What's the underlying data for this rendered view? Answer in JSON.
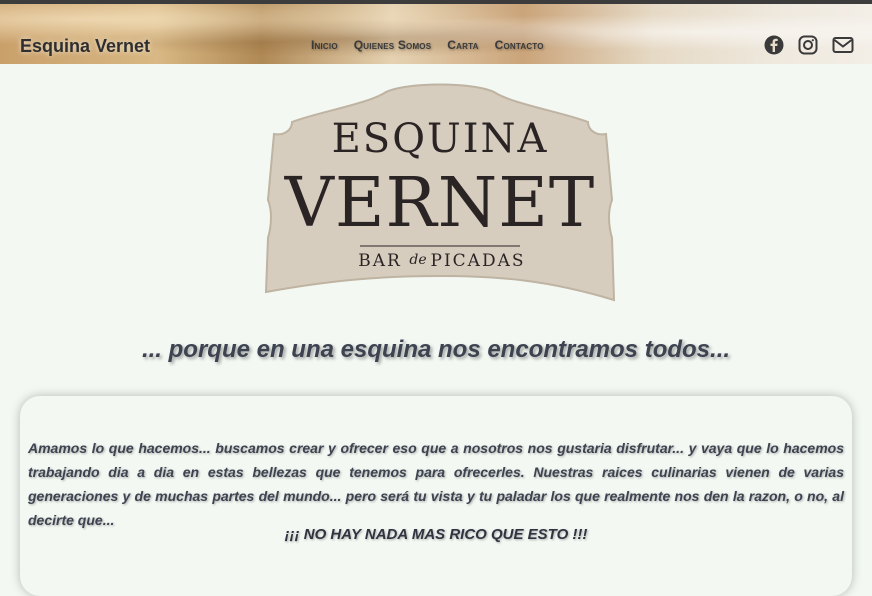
{
  "header": {
    "brand": "Esquina Vernet",
    "nav": [
      "Inicio",
      "Quienes Somos",
      "Carta",
      "Contacto"
    ],
    "social_icons": [
      "facebook-icon",
      "instagram-icon",
      "envelope-icon"
    ]
  },
  "logo": {
    "line1": "ESQUINA",
    "line2": "VERNET",
    "sub_left": "BAR",
    "sub_mid": "de",
    "sub_right": "PICADAS"
  },
  "tagline": "... porque en una esquina nos encontramos todos...",
  "about": {
    "text": "Amamos lo que hacemos... buscamos crear y ofrecer eso que a nosotros nos gustaria disfrutar... y vaya que lo hacemos trabajando dia a dia en estas bellezas que tenemos para ofrecerles. Nuestras raices culinarias vienen de varias generaciones y de muchas partes del mundo... pero será tu vista y tu paladar los que realmente nos den la razon, o no, al decirte que...",
    "highlight": "¡¡¡ NO HAY NADA MAS RICO QUE ESTO !!!"
  },
  "colors": {
    "background": "#f3f8f3",
    "text": "#3d4350",
    "logo_fill": "#d7cdbf",
    "logo_ink": "#2b2424"
  }
}
